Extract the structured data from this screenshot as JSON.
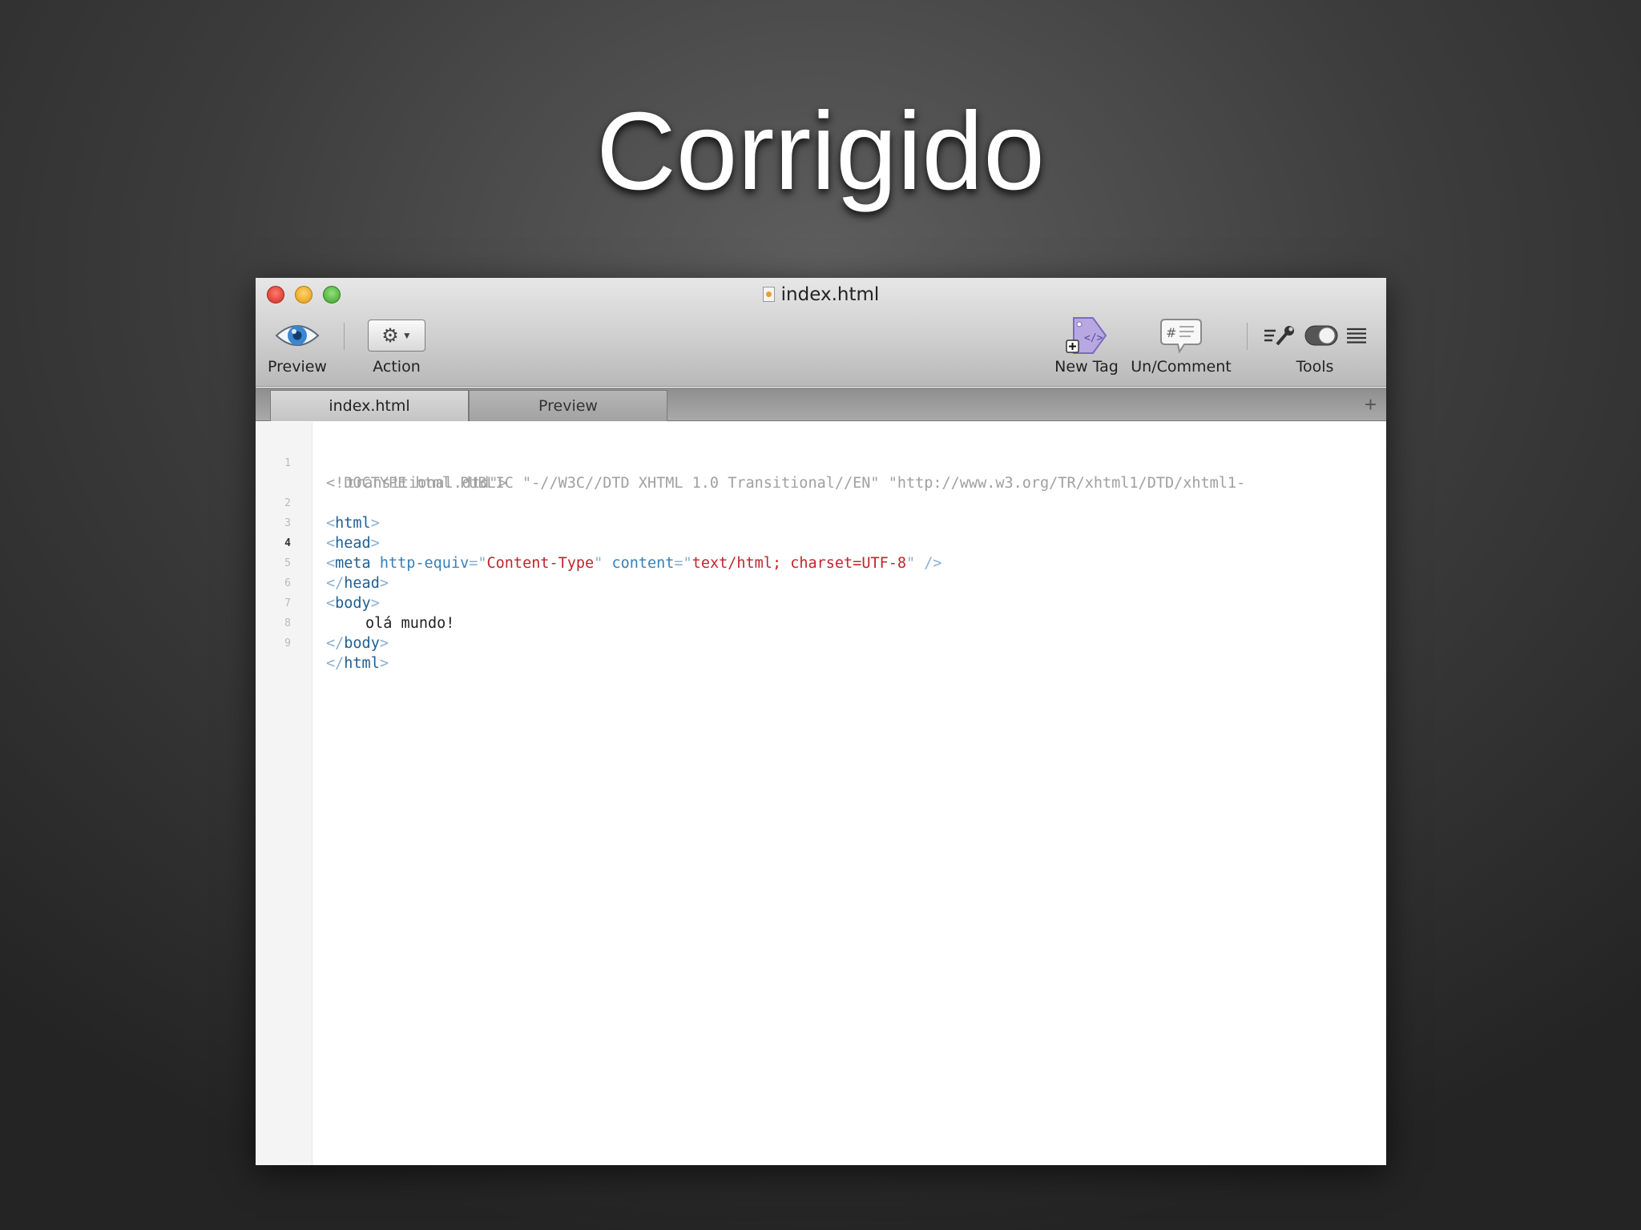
{
  "slide": {
    "title": "Corrigido"
  },
  "window": {
    "title": "index.html"
  },
  "toolbar": {
    "preview_label": "Preview",
    "action_label": "Action",
    "new_tag_label": "New Tag",
    "comment_label": "Un/Comment",
    "tools_label": "Tools"
  },
  "tabs": [
    {
      "label": "index.html",
      "active": true
    },
    {
      "label": "Preview",
      "active": false
    }
  ],
  "editor": {
    "line_numbers": [
      "1",
      "2",
      "3",
      "4",
      "5",
      "6",
      "7",
      "8",
      "9"
    ],
    "current_line": "4",
    "doctype_line1": "<!DOCTYPE html PUBLIC \"-//W3C//DTD XHTML 1.0 Transitional//EN\" \"http://www.w3.org/TR/xhtml1/DTD/xhtml1-",
    "doctype_line2": "transitional.dtd\">",
    "tag_html": "html",
    "tag_head": "head",
    "tag_meta": "meta",
    "attr_http_equiv": "http-equiv",
    "val_content_type": "Content-Type",
    "attr_content": "content",
    "val_content": "text/html; charset=UTF-8",
    "tag_body": "body",
    "body_text": "olá mundo!"
  },
  "colors": {
    "tag": "#1f5f93",
    "attribute": "#3a7fb6",
    "string": "#c0252a",
    "doctype": "#a0a0a0"
  }
}
